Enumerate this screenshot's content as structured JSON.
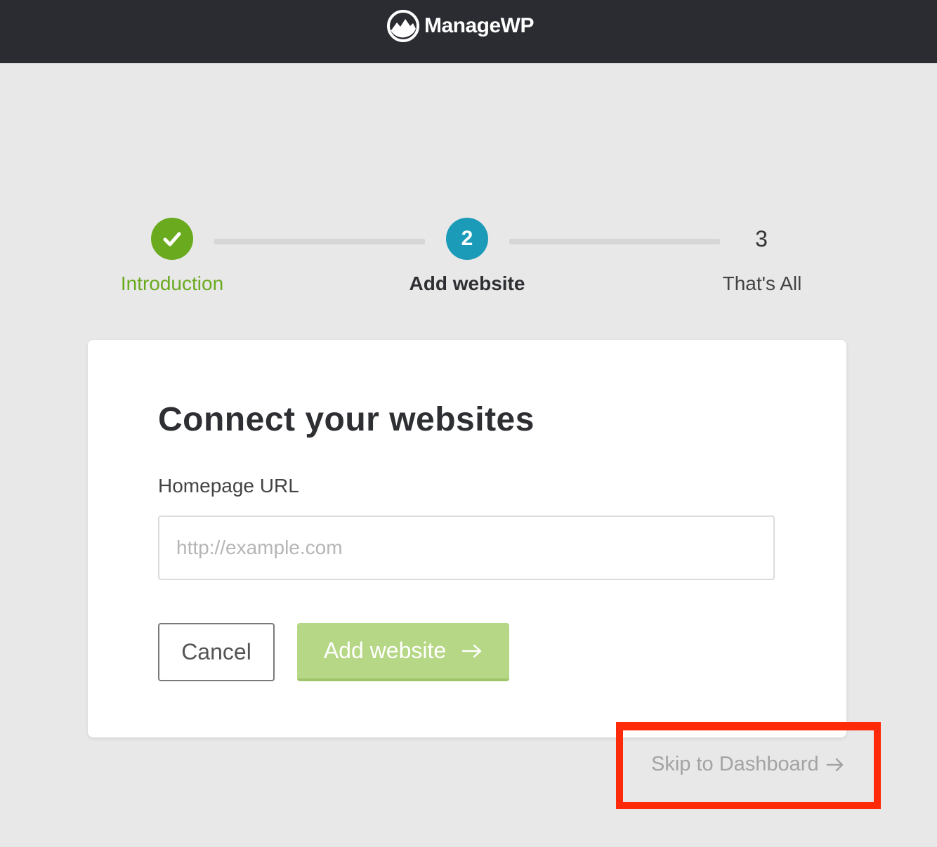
{
  "header": {
    "brand": "ManageWP",
    "logo_icon": "mountain-logo-icon"
  },
  "stepper": {
    "steps": [
      {
        "label": "Introduction",
        "state": "completed",
        "icon": "check-icon",
        "color": "#6aaa1f"
      },
      {
        "label": "Add website",
        "number": "2",
        "state": "active",
        "color": "#1b9bb8"
      },
      {
        "label": "That's All",
        "number": "3",
        "state": "upcoming",
        "color": "#444444"
      }
    ]
  },
  "card": {
    "title": "Connect your websites",
    "url_field": {
      "label": "Homepage URL",
      "placeholder": "http://example.com",
      "value": ""
    },
    "cancel_label": "Cancel",
    "add_label": "Add website",
    "add_icon": "arrow-right-icon",
    "add_button_color": "#b6d785"
  },
  "skip": {
    "label": "Skip to Dashboard",
    "icon": "arrow-right-icon"
  },
  "annotation": {
    "highlight_color": "#ff2a0a"
  }
}
